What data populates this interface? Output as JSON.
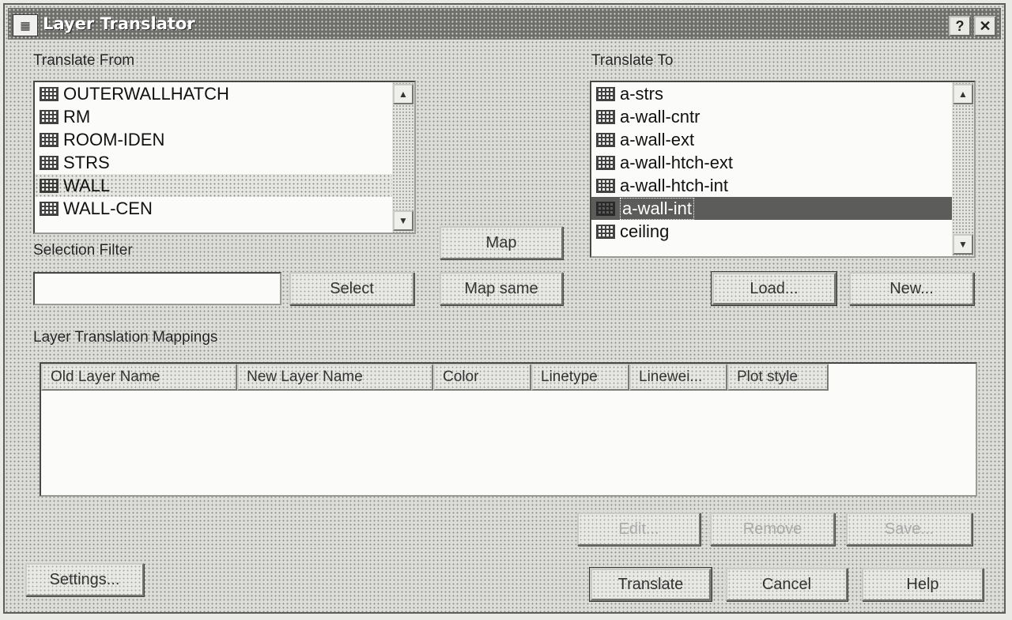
{
  "window": {
    "title": "Layer Translator",
    "help_btn": "?",
    "close_btn": "✕",
    "icon": "app-icon"
  },
  "translate_from": {
    "label": "Translate From",
    "items": [
      {
        "name": "OUTERWALLHATCH"
      },
      {
        "name": "RM"
      },
      {
        "name": "ROOM-IDEN"
      },
      {
        "name": "STRS"
      },
      {
        "name": "WALL"
      },
      {
        "name": "WALL-CEN"
      }
    ]
  },
  "translate_to": {
    "label": "Translate To",
    "items": [
      {
        "name": "a-strs"
      },
      {
        "name": "a-wall-cntr"
      },
      {
        "name": "a-wall-ext"
      },
      {
        "name": "a-wall-htch-ext"
      },
      {
        "name": "a-wall-htch-int"
      },
      {
        "name": "a-wall-int",
        "selected": true
      },
      {
        "name": "ceiling"
      }
    ]
  },
  "selection_filter": {
    "label": "Selection Filter",
    "value": ""
  },
  "buttons": {
    "map": "Map",
    "map_same": "Map same",
    "load": "Load...",
    "new": "New...",
    "edit": "Edit...",
    "remove": "Remove",
    "save": "Save...",
    "select": "Select",
    "settings": "Settings...",
    "translate": "Translate",
    "cancel": "Cancel",
    "help": "Help"
  },
  "mappings": {
    "label": "Layer Translation Mappings",
    "columns": [
      "Old Layer Name",
      "New Layer Name",
      "Color",
      "Linetype",
      "Linewei...",
      "Plot style"
    ]
  }
}
